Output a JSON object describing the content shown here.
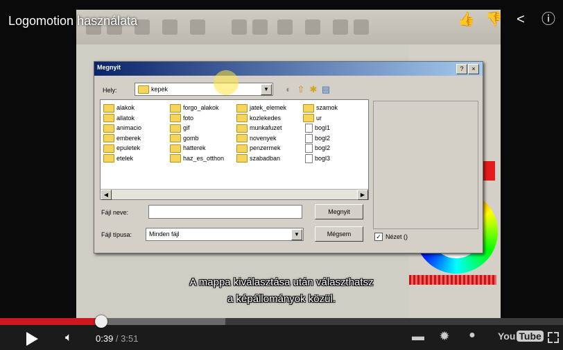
{
  "video": {
    "title": "Logomotion használata",
    "subtitle_line1": "A mappa kiválasztása után választhatsz",
    "subtitle_line2": "a képállományok közül."
  },
  "dialog": {
    "title": "Megnyit",
    "help_btn": "?",
    "close_btn": "×",
    "look_in_label": "Hely:",
    "look_in_value": "kepek",
    "columns": [
      [
        {
          "name": "alakok",
          "type": "folder"
        },
        {
          "name": "allatok",
          "type": "folder"
        },
        {
          "name": "animacio",
          "type": "folder"
        },
        {
          "name": "emberek",
          "type": "folder"
        },
        {
          "name": "epuletek",
          "type": "folder"
        },
        {
          "name": "etelek",
          "type": "folder"
        }
      ],
      [
        {
          "name": "forgo_alakok",
          "type": "folder"
        },
        {
          "name": "foto",
          "type": "folder"
        },
        {
          "name": "gif",
          "type": "folder"
        },
        {
          "name": "gomb",
          "type": "folder"
        },
        {
          "name": "hatterek",
          "type": "folder"
        },
        {
          "name": "haz_es_otthon",
          "type": "folder"
        }
      ],
      [
        {
          "name": "jatek_elemek",
          "type": "folder"
        },
        {
          "name": "kozlekedes",
          "type": "folder"
        },
        {
          "name": "munkafuzet",
          "type": "folder"
        },
        {
          "name": "novenyek",
          "type": "folder"
        },
        {
          "name": "penzermek",
          "type": "folder"
        },
        {
          "name": "szabadban",
          "type": "folder"
        }
      ],
      [
        {
          "name": "szamok",
          "type": "folder"
        },
        {
          "name": "ur",
          "type": "folder"
        },
        {
          "name": "bogl1",
          "type": "file"
        },
        {
          "name": "bogl2",
          "type": "file"
        },
        {
          "name": "bogl2",
          "type": "file"
        },
        {
          "name": "bogl3",
          "type": "file"
        }
      ]
    ],
    "filename_label": "Fájl neve:",
    "filename_value": "",
    "filetype_label": "Fájl típusa:",
    "filetype_value": "Minden fájl",
    "open_btn": "Megnyit",
    "cancel_btn": "Mégsem",
    "preview_check": "Nézet ()"
  },
  "player": {
    "current_time": "0:39",
    "separator": " / ",
    "duration": "3:51",
    "played_fraction": 0.18,
    "buffered_fraction": 0.4,
    "yt_you": "You",
    "yt_tube": "Tube"
  },
  "icons": {
    "like": "thumbs-up-icon",
    "dislike": "thumbs-down-icon",
    "share": "share-icon",
    "info": "info-icon",
    "play": "play-icon",
    "volume": "volume-icon",
    "captions": "captions-icon",
    "settings": "gear-icon",
    "fullscreen": "fullscreen-icon"
  },
  "colors": {
    "progress_played": "#cc181e",
    "dialog_title_start": "#0a246a",
    "dialog_title_end": "#a6caf0"
  }
}
